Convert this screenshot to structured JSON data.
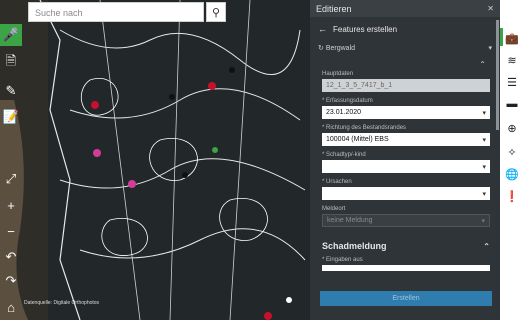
{
  "search": {
    "placeholder": "Suche nach"
  },
  "map": {
    "attribution": "Datenquelle: Digitale Orthophotos"
  },
  "panel": {
    "title": "Editieren",
    "back_label": "Features erstellen",
    "layer_name": "Bergwald",
    "fields": [
      {
        "label": "Hauptdaten",
        "value": "12_1_3_5_7417_b_1",
        "kind": "readonly"
      },
      {
        "label": "* Erfassungsdatum",
        "value": "23.01.2020",
        "kind": "date"
      },
      {
        "label": "* Richtung des Bestandsrandes",
        "value": "100004 (Mittel) EBS",
        "kind": "select"
      },
      {
        "label": "* Schadtyp/-kind",
        "value": "",
        "kind": "select"
      },
      {
        "label": "* Ursachen",
        "value": "",
        "kind": "select"
      },
      {
        "label": "Meldeort",
        "value": "keine Meldung",
        "kind": "disabled"
      }
    ],
    "section": "Schadmeldung",
    "section_field": "* Eingaben aus",
    "submit": "Erstellen"
  },
  "colors": {
    "accent": "#3aa447",
    "submit": "#2f7cae",
    "panel": "#2f3438"
  }
}
